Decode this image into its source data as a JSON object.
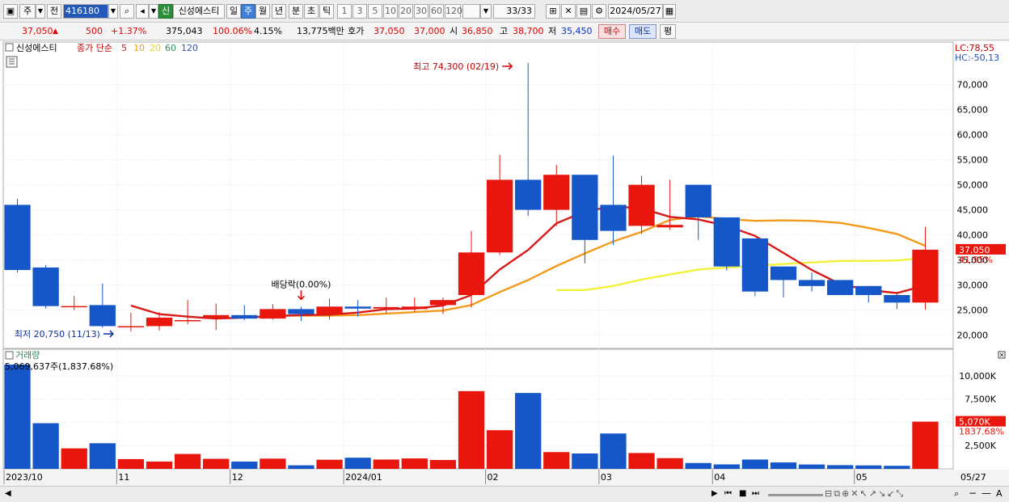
{
  "toolbar": {
    "market_type": "주",
    "prev_label": "전",
    "code": "416180",
    "badge": "신",
    "stock_name": "신성에스티",
    "period_day": "일",
    "period_week": "주",
    "period_month": "월",
    "period_year": "년",
    "period_minute": "분",
    "period_second": "초",
    "period_tick": "틱",
    "intervals": [
      "1",
      "3",
      "5",
      "10",
      "20",
      "30",
      "60",
      "120"
    ],
    "count": "33/33",
    "date": "2024/05/27"
  },
  "quote": {
    "price": "37,050",
    "change": "500",
    "change_pct": "+1.37%",
    "volume": "375,043",
    "vol_ratio": "100.06%",
    "turnover": "4.15%",
    "amount": "13,775백만",
    "hoga_label": "호가",
    "ask": "37,050",
    "bid": "37,000",
    "open_label": "시",
    "open": "36,850",
    "high_label": "고",
    "high": "38,700",
    "low_label": "저",
    "low": "35,450",
    "buy_label": "매수",
    "sell_label": "매도",
    "avg_label": "평"
  },
  "colors": {
    "up": "#e8160c",
    "down": "#1556c9",
    "ma5": "#d91818",
    "ma10": "#f29a1a",
    "ma20": "#f2f23a",
    "ma60": "#2e8b57",
    "ma120": "#3050c0"
  },
  "chart_data": [
    {
      "type": "candlestick",
      "period": "weekly",
      "stock": "신성에스티",
      "legend": {
        "name": "신성에스티",
        "series_label": "종가 단순",
        "ma_periods": [
          "5",
          "10",
          "20",
          "60",
          "120"
        ]
      },
      "x": [
        "2023/10/09",
        "2023/10/16",
        "2023/10/23",
        "2023/10/30",
        "2023/11/06",
        "2023/11/13",
        "2023/11/20",
        "2023/11/27",
        "2023/12/04",
        "2023/12/11",
        "2023/12/18",
        "2023/12/26",
        "2024/01/02",
        "2024/01/08",
        "2024/01/15",
        "2024/01/22",
        "2024/01/29",
        "2024/02/05",
        "2024/02/13",
        "2024/02/19",
        "2024/02/26",
        "2024/03/04",
        "2024/03/11",
        "2024/03/18",
        "2024/03/25",
        "2024/04/01",
        "2024/04/08",
        "2024/04/15",
        "2024/04/22",
        "2024/04/29",
        "2024/05/06",
        "2024/05/13",
        "2024/05/20"
      ],
      "open": [
        46000,
        33500,
        25800,
        26000,
        21800,
        21800,
        23000,
        23500,
        24000,
        23300,
        25200,
        24200,
        25700,
        25300,
        25200,
        26000,
        28000,
        36500,
        51000,
        45000,
        52000,
        46000,
        41800,
        41500,
        50000,
        43500,
        39300,
        33700,
        31000,
        31000,
        29800,
        28000,
        26500
      ],
      "high": [
        47200,
        34000,
        27800,
        30300,
        24500,
        24600,
        27000,
        26300,
        26000,
        26200,
        25700,
        27300,
        27000,
        27500,
        27500,
        27500,
        40800,
        56000,
        74300,
        54000,
        47300,
        55800,
        51800,
        51000,
        44800,
        39500,
        36500,
        33000,
        32500,
        30500,
        29600,
        28600,
        41600
      ],
      "low": [
        32500,
        25300,
        25000,
        21500,
        20750,
        20900,
        22200,
        21000,
        23000,
        23100,
        22800,
        23100,
        23700,
        24300,
        24700,
        24200,
        25500,
        36000,
        43800,
        41800,
        34300,
        38000,
        40200,
        41000,
        39000,
        32900,
        27800,
        27500,
        28700,
        29100,
        26500,
        25200,
        25100
      ],
      "close": [
        33000,
        25800,
        25800,
        21800,
        21800,
        23500,
        23000,
        24000,
        23300,
        25200,
        24200,
        25700,
        25300,
        25600,
        25700,
        27000,
        36500,
        51000,
        45000,
        52000,
        39000,
        40800,
        50000,
        42000,
        43500,
        33700,
        28700,
        31000,
        29800,
        28000,
        28000,
        26500,
        37050
      ],
      "ma5": [
        null,
        null,
        null,
        null,
        25900,
        24200,
        23700,
        23300,
        23500,
        23800,
        24000,
        24100,
        24500,
        25200,
        25300,
        25900,
        28000,
        33100,
        37000,
        42300,
        44700,
        45700,
        45300,
        43600,
        43100,
        41800,
        39800,
        36400,
        33000,
        30200,
        29000,
        28400,
        29900
      ],
      "ma10": [
        null,
        null,
        null,
        null,
        null,
        null,
        null,
        null,
        null,
        23900,
        23900,
        23900,
        24000,
        24300,
        24600,
        24900,
        26000,
        28600,
        31000,
        33800,
        36300,
        38700,
        40600,
        43000,
        43700,
        43200,
        42800,
        42900,
        42800,
        42400,
        41400,
        40200,
        37800
      ],
      "ma20": [
        null,
        null,
        null,
        null,
        null,
        null,
        null,
        null,
        null,
        null,
        null,
        null,
        null,
        null,
        null,
        null,
        null,
        null,
        null,
        29000,
        29000,
        29800,
        31100,
        32100,
        33100,
        33500,
        33800,
        34200,
        34500,
        34800,
        34800,
        34900,
        35400
      ],
      "volume_unit": "K",
      "volume": [
        11200,
        4900,
        2200,
        2750,
        1050,
        780,
        1600,
        1080,
        780,
        1100,
        380,
        980,
        1200,
        1000,
        1120,
        950,
        8350,
        4150,
        8150,
        1800,
        1650,
        3800,
        1700,
        1150,
        630,
        480,
        1000,
        690,
        470,
        400,
        370,
        330,
        5070
      ],
      "y_price": {
        "min": 18000,
        "max": 78000,
        "ticks": [
          "70,000",
          "65,000",
          "60,000",
          "55,000",
          "50,000",
          "45,000",
          "40,000",
          "35,000",
          "30,000",
          "25,000",
          "20,000"
        ]
      },
      "y_volume": {
        "max": 11200,
        "ticks": [
          "10,000K",
          "7,500K",
          "5,000K",
          "2,500K"
        ]
      },
      "x_labels": [
        "2023/10",
        "11",
        "12",
        "2024/01",
        "02",
        "03",
        "04",
        "05",
        "05/27"
      ],
      "annotations": {
        "high": "최고 74,300 (02/19)",
        "low": "최저 20,750 (11/13)",
        "dividend": "배당락(0.00%)",
        "lc": "LC:78,55",
        "hc": "HC:-50,13",
        "last_price": "37,050",
        "last_pct": "41.95%",
        "volume_label": "거래량",
        "volume_info": "5,069,637주(1,837.68%)",
        "last_volume": "5,070K",
        "last_volume_pct": "1837.68%"
      }
    }
  ]
}
